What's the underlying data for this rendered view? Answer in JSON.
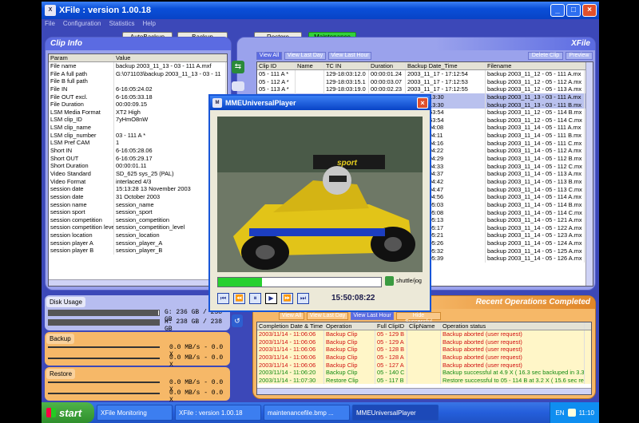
{
  "window": {
    "title": "XFile : version 1.00.18",
    "icon": "xfile-app-icon"
  },
  "menu": [
    "File",
    "Configuration",
    "Statistics",
    "Help"
  ],
  "toolbar": {
    "autobackup": "AutoBackup",
    "backup": "Backup",
    "restore": "Restore",
    "maintenance": "Maintenance"
  },
  "clipinfo": {
    "title": "Clip Info",
    "headers": [
      "Param",
      "Value"
    ],
    "rows": [
      [
        "File name",
        "backup 2003_11_13 - 03 - 111 A.mxf"
      ],
      [
        "File A full path",
        "G:\\071103\\backup 2003_11_13 - 03 - 11"
      ],
      [
        "File B full path",
        ""
      ],
      [
        "File IN",
        "6-16:05:24.02"
      ],
      [
        "File OUT excl.",
        "6-16:05:33.18"
      ],
      [
        "File Duration",
        "00:00:09.15"
      ],
      [
        "LSM Media Format",
        "XT2 High"
      ],
      [
        "LSM clip_ID",
        "7yHmO8nW"
      ],
      [
        "LSM clip_name",
        ""
      ],
      [
        "LSM clip_number",
        "03 - 111 A *"
      ],
      [
        "LSM Pref CAM",
        "1"
      ],
      [
        "Short IN",
        "6-16:05:28.06"
      ],
      [
        "Short OUT",
        "6-16:05:29.17"
      ],
      [
        "Short Duration",
        "00:00:01.11"
      ],
      [
        "Video Standard",
        "SD_625 sys_25 (PAL)"
      ],
      [
        "Video Format",
        "interlaced 4/3"
      ],
      [
        "session date",
        "15:13:28    13 November 2003"
      ],
      [
        "session date",
        "31 October 2003"
      ],
      [
        "session name",
        "session_name"
      ],
      [
        "session sport",
        "session_sport"
      ],
      [
        "session competition",
        "session_competition"
      ],
      [
        "session competition leve",
        "session_competition_level"
      ],
      [
        "session location",
        "session_location"
      ],
      [
        "session player A",
        "session_player_A"
      ],
      [
        "session player B",
        "session_player_B"
      ]
    ]
  },
  "xfile": {
    "title": "XFile",
    "view_all": "View All",
    "view_last_day": "View Last Day",
    "view_last_hour": "View Last Hour",
    "delete_clip": "Delete Clip",
    "preview": "Preview",
    "headers": [
      "Clip ID",
      "Name",
      "TC IN",
      "Duration",
      "Backup Date_Time",
      "Filename"
    ],
    "rows": [
      [
        "05 - 111 A *",
        "",
        "129-18:03:12.0",
        "00:00:01.24",
        "2003_11_17 - 17:12:54",
        "backup 2003_11_12 - 05 - 111 A.mx"
      ],
      [
        "05 - 112 A *",
        "",
        "129-18:03:15.1",
        "00:00:03.07",
        "2003_11_17 - 17:12:53",
        "backup 2003_11_12 - 05 - 112 A.mx"
      ],
      [
        "05 - 113 A *",
        "",
        "129-18:03:19.0",
        "00:00:02.23",
        "2003_11_17 - 17:12:55",
        "backup 2003_11_12 - 05 - 113 A.mx"
      ],
      [
        "",
        "",
        "",
        "",
        "/14 - 15:13:30",
        "backup 2003_11_13 - 03 - 111 A.mx"
      ],
      [
        "",
        "",
        "",
        "",
        "/14 - 15:13:30",
        "backup 2003_11_13 - 03 - 111 B.mx"
      ],
      [
        "",
        "",
        "",
        "",
        "/14 - 15:53:54",
        "backup 2003_11_12 - 05 - 114 B.mx"
      ],
      [
        "",
        "",
        "",
        "",
        "/14 - 15:53:54",
        "backup 2003_11_12 - 05 - 114 C.mx"
      ],
      [
        "",
        "",
        "",
        "",
        "/14 - 11:04:08",
        "backup 2003_11_14 - 05 - 111 A.mx"
      ],
      [
        "",
        "",
        "",
        "",
        "/14 - 11:04:11",
        "backup 2003_11_14 - 05 - 111 B.mx"
      ],
      [
        "",
        "",
        "",
        "",
        "/14 - 11:04:16",
        "backup 2003_11_14 - 05 - 111 C.mx"
      ],
      [
        "",
        "",
        "",
        "",
        "/14 - 11:04:22",
        "backup 2003_11_14 - 05 - 112 A.mx"
      ],
      [
        "",
        "",
        "",
        "",
        "/14 - 11:04:29",
        "backup 2003_11_14 - 05 - 112 B.mx"
      ],
      [
        "",
        "",
        "",
        "",
        "/14 - 11:04:33",
        "backup 2003_11_14 - 05 - 112 C.mx"
      ],
      [
        "",
        "",
        "",
        "",
        "/14 - 11:04:37",
        "backup 2003_11_14 - 05 - 113 A.mx"
      ],
      [
        "",
        "",
        "",
        "",
        "/14 - 11:04:42",
        "backup 2003_11_14 - 05 - 113 B.mx"
      ],
      [
        "",
        "",
        "",
        "",
        "/14 - 11:04:47",
        "backup 2003_11_14 - 05 - 113 C.mx"
      ],
      [
        "",
        "",
        "",
        "",
        "/14 - 11:04:56",
        "backup 2003_11_14 - 05 - 114 A.mx"
      ],
      [
        "",
        "",
        "",
        "",
        "/14 - 11:05:03",
        "backup 2003_11_14 - 05 - 114 B.mx"
      ],
      [
        "",
        "",
        "",
        "",
        "/14 - 11:05:08",
        "backup 2003_11_14 - 05 - 114 C.mx"
      ],
      [
        "",
        "",
        "",
        "",
        "/14 - 11:05:13",
        "backup 2003_11_14 - 05 - 121 A.mx"
      ],
      [
        "",
        "",
        "",
        "",
        "/14 - 11:05:17",
        "backup 2003_11_14 - 05 - 122 A.mx"
      ],
      [
        "",
        "",
        "",
        "",
        "/14 - 11:05:21",
        "backup 2003_11_14 - 05 - 123 A.mx"
      ],
      [
        "",
        "",
        "",
        "",
        "/14 - 11:05:26",
        "backup 2003_11_14 - 05 - 124 A.mx"
      ],
      [
        "",
        "",
        "",
        "",
        "/14 - 11:05:32",
        "backup 2003_11_14 - 05 - 125 A.mx"
      ],
      [
        "",
        "",
        "",
        "",
        "/14 - 11:05:39",
        "backup 2003_11_14 - 05 - 126 A.mx"
      ]
    ],
    "selected_rows": [
      3,
      4
    ]
  },
  "disk": {
    "title": "Disk Usage",
    "g": "G: 236 GB / 238 GB",
    "h": "H: 238 GB / 238 GB",
    "g_frac": 0.99,
    "h_frac": 1.0
  },
  "backup": {
    "title": "Backup",
    "rate1": "0.0 MB/s - 0.0 X",
    "rate2": "0.0 MB/s - 0.0 X"
  },
  "restore": {
    "title": "Restore",
    "rate1": "0.0 MB/s - 0.0 X",
    "rate2": "0.0 MB/s - 0.0 X"
  },
  "recent": {
    "title": "Recent Operations Completed",
    "view_all": "View All",
    "view_last_day": "View Last Day",
    "view_last_hour": "View Last Hour",
    "hide_success": "Hide Successful",
    "headers": [
      "Completion Date & Time",
      "Operation",
      "Full ClipID",
      "ClipName",
      "Operation status"
    ],
    "rows": [
      [
        "2003/11/14 - 11:06:06",
        "Backup Clip",
        "05 - 129 B",
        "",
        "Backup aborted (user request)",
        "red"
      ],
      [
        "2003/11/14 - 11:06:06",
        "Backup Clip",
        "05 - 129 A",
        "",
        "Backup aborted (user request)",
        "red"
      ],
      [
        "2003/11/14 - 11:06:06",
        "Backup Clip",
        "05 - 128 B",
        "",
        "Backup aborted (user request)",
        "red"
      ],
      [
        "2003/11/14 - 11:06:06",
        "Backup Clip",
        "05 - 128 A",
        "",
        "Backup aborted (user request)",
        "red"
      ],
      [
        "2003/11/14 - 11:06:06",
        "Backup Clip",
        "05 - 127 A",
        "",
        "Backup aborted (user request)",
        "red"
      ],
      [
        "2003/11/14 - 11:06:20",
        "Backup Clip",
        "05 - 140 C",
        "",
        "Backup successful at 4.9 X ( 16.3 sec backuped in 3.3",
        "green"
      ],
      [
        "2003/11/14 - 11:07:30",
        "Restore Clip",
        "05 - 117 B",
        "",
        "Restore successful to 05 - 114 B at 3.2 X ( 15.6 sec re",
        "green"
      ]
    ]
  },
  "player": {
    "title": "MMEUniversalPlayer",
    "shuttle": "shuttle/jog",
    "timecode": "15:50:08:22",
    "progress": 0.27,
    "overlay_text": "sport"
  },
  "taskbar": {
    "start": "start",
    "tasks": [
      "XFile Monitoring",
      "XFile : version 1.00.18",
      "maintenancefile.bmp ...",
      "MMEUniversalPlayer"
    ],
    "lang": "EN",
    "clock": "11:10"
  },
  "colors": {
    "panel": "#9aa2ec",
    "orange": "#f0a040",
    "accent": "#5b6be2"
  }
}
